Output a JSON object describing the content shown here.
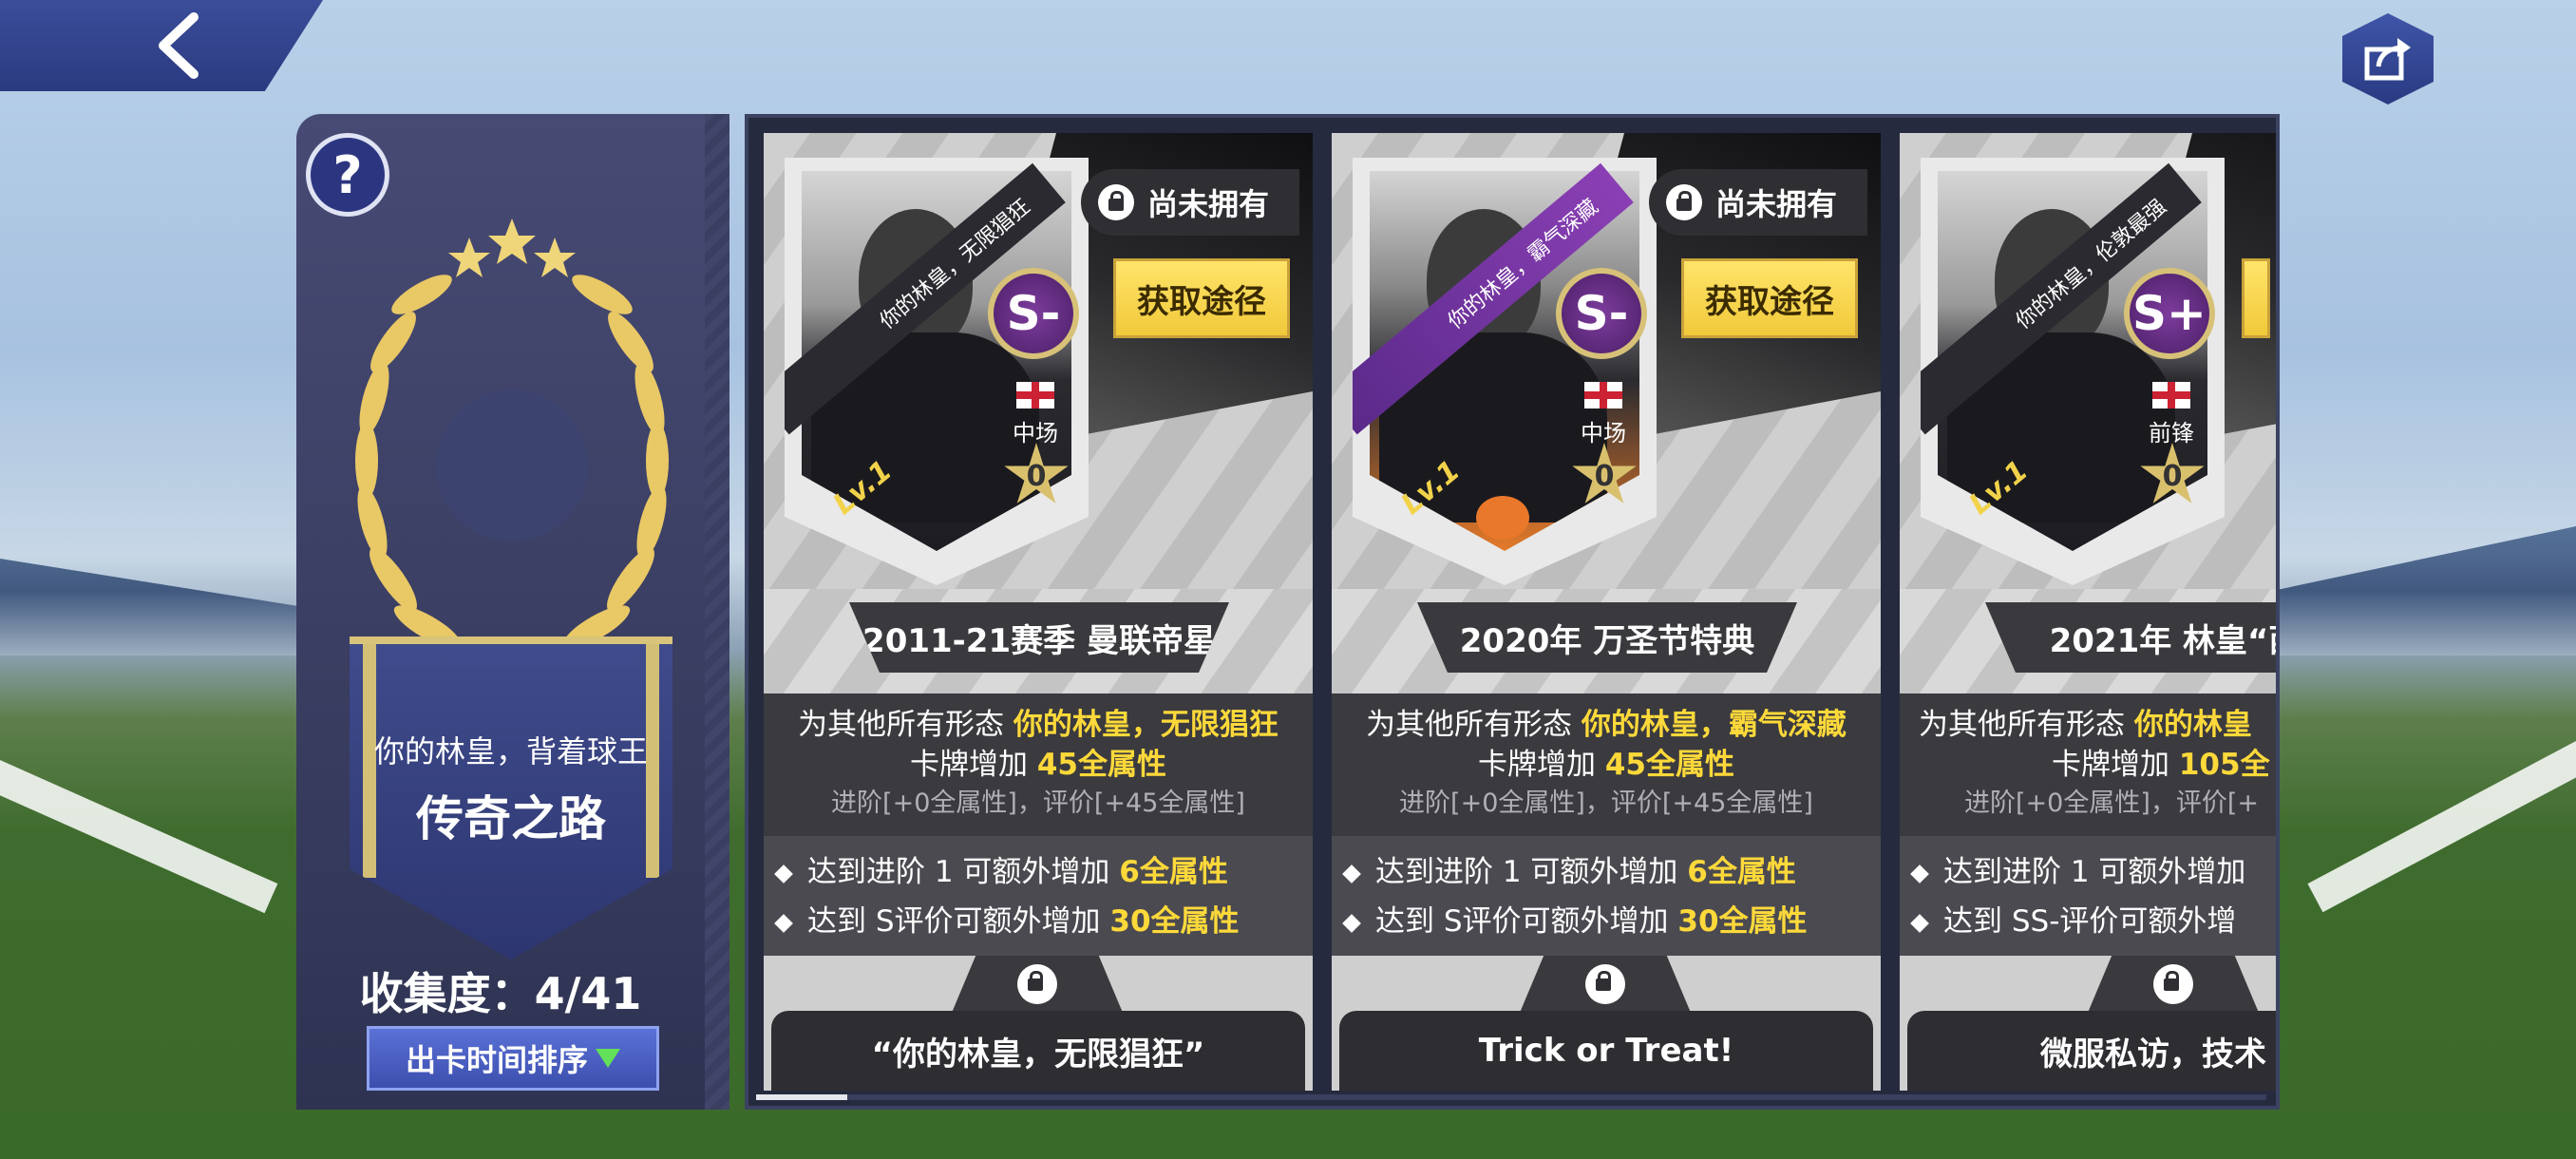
{
  "help": {
    "label": "?"
  },
  "collection": {
    "subtitle": "你的林皇，背着球王",
    "title": "传奇之路",
    "progress_label": "收集度：4/41",
    "collected": 4,
    "total": 41
  },
  "sort": {
    "label": "出卡时间排序"
  },
  "cards": [
    {
      "rank": "S-",
      "card_name": "你的林皇，无限猖狂",
      "level": "Lv.1",
      "position": "中场",
      "stars": "0",
      "status": "尚未拥有",
      "obtain": "获取途径",
      "season": "2011-21赛季 曼联帝星",
      "desc_prefix": "为其他所有形态",
      "desc_name": "你的林皇，无限猖狂",
      "desc_mid": "卡牌增加",
      "desc_value": "45全属性",
      "desc_note": "进阶[+0全属性]，评价[+45全属性]",
      "bonus1_text": "达到进阶 1 可额外增加",
      "bonus1_value": "6全属性",
      "bonus2_text": "达到 S评价可额外增加",
      "bonus2_value": "30全属性",
      "quote": "“你的林皇，无限猖狂”"
    },
    {
      "rank": "S-",
      "card_name": "你的林皇，霸气深藏",
      "level": "Lv.1",
      "position": "中场",
      "stars": "0",
      "status": "尚未拥有",
      "obtain": "获取途径",
      "season": "2020年 万圣节特典",
      "desc_prefix": "为其他所有形态",
      "desc_name": "你的林皇，霸气深藏",
      "desc_mid": "卡牌增加",
      "desc_value": "45全属性",
      "desc_note": "进阶[+0全属性]，评价[+45全属性]",
      "bonus1_text": "达到进阶 1 可额外增加",
      "bonus1_value": "6全属性",
      "bonus2_text": "达到 S评价可额外增加",
      "bonus2_value": "30全属性",
      "quote": "Trick or Treat!"
    },
    {
      "rank": "S+",
      "card_name": "你的林皇，伦敦最强",
      "level": "Lv.1",
      "position": "前锋",
      "stars": "0",
      "season": "2021年 林皇“西",
      "desc_prefix": "为其他所有形态",
      "desc_name": "你的林皇",
      "desc_mid": "卡牌增加",
      "desc_value": "105全",
      "desc_note": "进阶[+0全属性]，评价[+",
      "bonus1_text": "达到进阶 1 可额外增加",
      "bonus2_text": "达到 SS-评价可额外增",
      "quote": "微服私访，技术"
    }
  ],
  "scroll": {
    "position": 0.0
  },
  "colors": {
    "accent_yellow": "#ffd93a",
    "panel_navy": "#2f3352",
    "sort_button": "#4a5fc4"
  },
  "icons": {
    "back": "chevron-left-icon",
    "share": "share-icon",
    "lock": "lock-icon",
    "laurel": "laurel-wreath-icon"
  }
}
